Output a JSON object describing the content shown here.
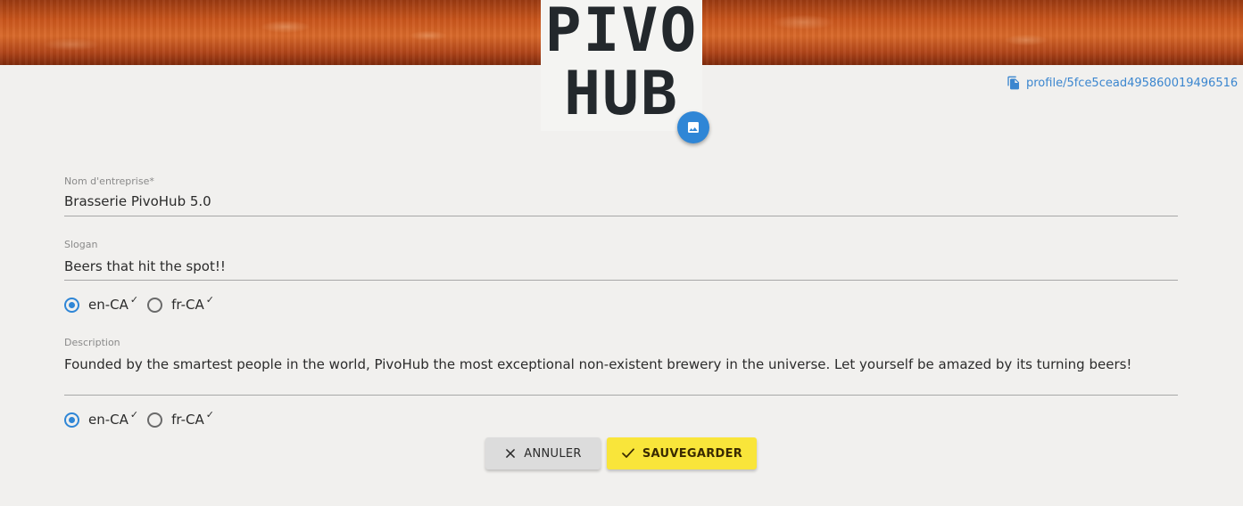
{
  "brand": {
    "logo_line1": "PIVO",
    "logo_line2": "HUB"
  },
  "profile_link": {
    "text": "profile/5fce5cead495860019496516",
    "icon": "copy-icon"
  },
  "image_button": {
    "icon": "image-icon"
  },
  "form": {
    "company_name": {
      "label": "Nom d'entreprise*",
      "value": "Brasserie PivoHub 5.0"
    },
    "slogan": {
      "label": "Slogan",
      "value": "Beers that hit the spot!!",
      "languages": [
        {
          "label": "en-CA",
          "check": "✓",
          "selected": true
        },
        {
          "label": "fr-CA",
          "check": "✓",
          "selected": false
        }
      ]
    },
    "description": {
      "label": "Description",
      "value": "Founded by the smartest people in the world, PivoHub the most exceptional non-existent brewery in the universe. Let yourself be amazed by its turning beers!",
      "languages": [
        {
          "label": "en-CA",
          "check": "✓",
          "selected": true
        },
        {
          "label": "fr-CA",
          "check": "✓",
          "selected": false
        }
      ]
    }
  },
  "actions": {
    "cancel_label": "ANNULER",
    "cancel_icon": "close-icon",
    "save_label": "SAUVEGARDER",
    "save_icon": "check-icon"
  },
  "colors": {
    "primary": "#2f86d6",
    "save_button": "#f9e53a",
    "cancel_button": "#dcdcdc",
    "background": "#f1f0ee",
    "banner": "#c8551c",
    "link": "#3b86cf"
  }
}
